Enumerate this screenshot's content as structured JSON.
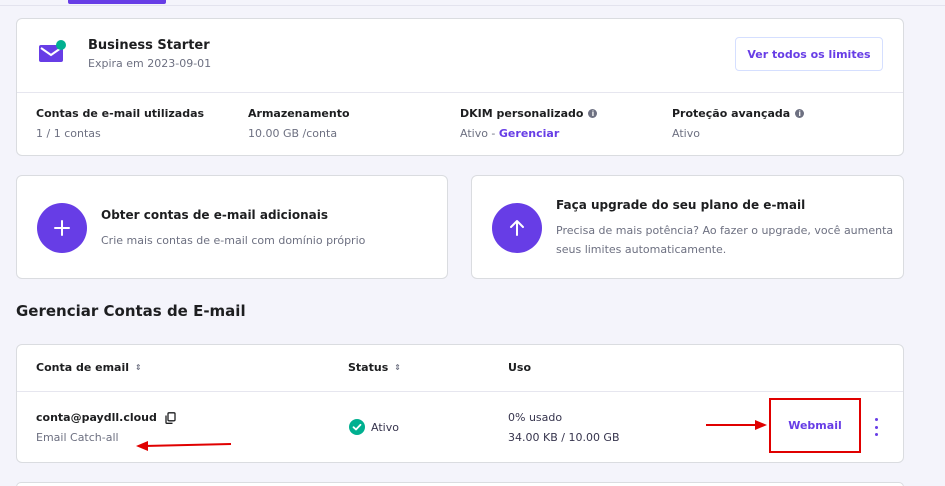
{
  "plan": {
    "title": "Business Starter",
    "expiry": "Expira em 2023-09-01",
    "view_limits_label": "Ver todos os limites",
    "stats": [
      {
        "label": "Contas de e-mail utilizadas",
        "value": "1 / 1 contas"
      },
      {
        "label": "Armazenamento",
        "value": "10.00 GB /conta"
      },
      {
        "label": "DKIM personalizado",
        "value_prefix": "Ativo - ",
        "link": "Gerenciar"
      },
      {
        "label": "Proteção avançada",
        "value": "Ativo"
      }
    ],
    "info_icon_glyph": "i"
  },
  "features": [
    {
      "title": "Obter contas de e-mail adicionais",
      "description": "Crie mais contas de e-mail com domínio próprio",
      "icon": "plus-icon"
    },
    {
      "title": "Faça upgrade do seu plano de e-mail",
      "description_line1": "Precisa de mais potência? Ao fazer o upgrade, você aumenta",
      "description_line2": "seus limites automaticamente.",
      "icon": "arrow-up-icon"
    }
  ],
  "section_title": "Gerenciar Contas de E-mail",
  "table": {
    "columns": [
      "Conta de email",
      "Status",
      "Uso"
    ],
    "rows": [
      {
        "email": "conta@paydll.cloud",
        "type": "Email Catch-all",
        "status": "Ativo",
        "usage_percent": "0% usado",
        "usage_size": "34.00 KB / 10.00 GB",
        "action_label": "Webmail"
      }
    ]
  },
  "colors": {
    "accent": "#673de6",
    "annotation_red": "#e00000",
    "status_green": "#00b090"
  }
}
